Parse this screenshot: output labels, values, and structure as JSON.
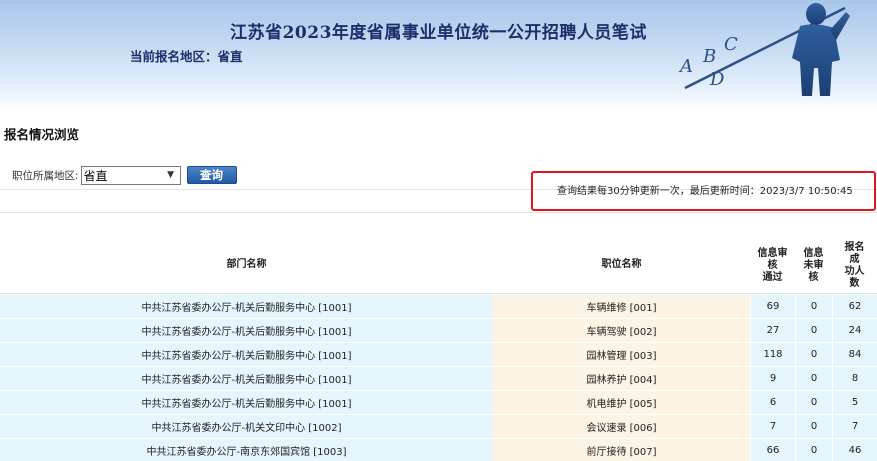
{
  "header": {
    "title": "江苏省2023年度省属事业单位统一公开招聘人员笔试",
    "region_label": "当前报名地区：省直"
  },
  "section_title": "报名情况浏览",
  "filter": {
    "label": "职位所属地区:",
    "selected": "省直",
    "query_label": "查询"
  },
  "update_notice": "查询结果每30分钟更新一次，最后更新时间：2023/3/7 10:50:45",
  "table": {
    "columns": {
      "dept": "部门名称",
      "position": "职位名称",
      "reviewed": [
        "信息审",
        "核",
        "通过"
      ],
      "unreviewed": [
        "信息",
        "未审",
        "核"
      ],
      "success": [
        "报名",
        "成",
        "功人",
        "数"
      ]
    },
    "rows": [
      {
        "dept": "中共江苏省委办公厅-机关后勤服务中心 [1001]",
        "position": "车辆维修 [001]",
        "reviewed": "69",
        "unreviewed": "0",
        "success": "62"
      },
      {
        "dept": "中共江苏省委办公厅-机关后勤服务中心 [1001]",
        "position": "车辆驾驶 [002]",
        "reviewed": "27",
        "unreviewed": "0",
        "success": "24"
      },
      {
        "dept": "中共江苏省委办公厅-机关后勤服务中心 [1001]",
        "position": "园林管理 [003]",
        "reviewed": "118",
        "unreviewed": "0",
        "success": "84"
      },
      {
        "dept": "中共江苏省委办公厅-机关后勤服务中心 [1001]",
        "position": "园林养护 [004]",
        "reviewed": "9",
        "unreviewed": "0",
        "success": "8"
      },
      {
        "dept": "中共江苏省委办公厅-机关后勤服务中心 [1001]",
        "position": "机电维护 [005]",
        "reviewed": "6",
        "unreviewed": "0",
        "success": "5"
      },
      {
        "dept": "中共江苏省委办公厅-机关文印中心 [1002]",
        "position": "会议速录 [006]",
        "reviewed": "7",
        "unreviewed": "0",
        "success": "7"
      },
      {
        "dept": "中共江苏省委办公厅-南京东郊国宾馆 [1003]",
        "position": "前厅接待 [007]",
        "reviewed": "66",
        "unreviewed": "0",
        "success": "46"
      }
    ]
  },
  "colors": {
    "title": "#1c2f6b",
    "highlight_border": "#e5141c",
    "row_blue": "#e4f5fb",
    "row_cream": "#fbf3e3",
    "button": "#1f5aa6"
  }
}
